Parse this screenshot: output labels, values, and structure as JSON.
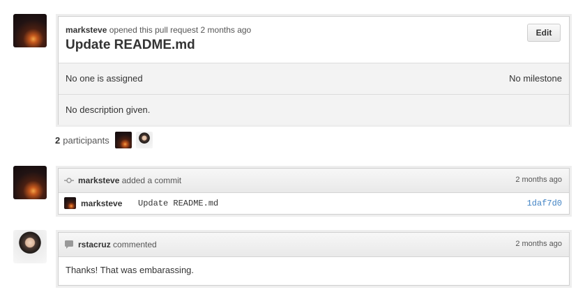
{
  "pull_request": {
    "author": "marksteve",
    "opened_text": "opened this pull request",
    "time": "2 months ago",
    "title": "Update README.md",
    "edit_label": "Edit",
    "assignee_text": "No one is assigned",
    "milestone_text": "No milestone",
    "description": "No description given."
  },
  "participants": {
    "count": "2",
    "label": "participants"
  },
  "commit_event": {
    "icon": "commit-icon",
    "author": "marksteve",
    "action": "added a commit",
    "time": "2 months ago",
    "commit_author": "marksteve",
    "commit_message": "Update README.md",
    "sha": "1daf7d0"
  },
  "comment_event": {
    "icon": "comment-icon",
    "author": "rstacruz",
    "action": "commented",
    "time": "2 months ago",
    "body": "Thanks! That was embarassing."
  },
  "colors": {
    "link": "#4183c4",
    "border": "#cfcfcf"
  }
}
